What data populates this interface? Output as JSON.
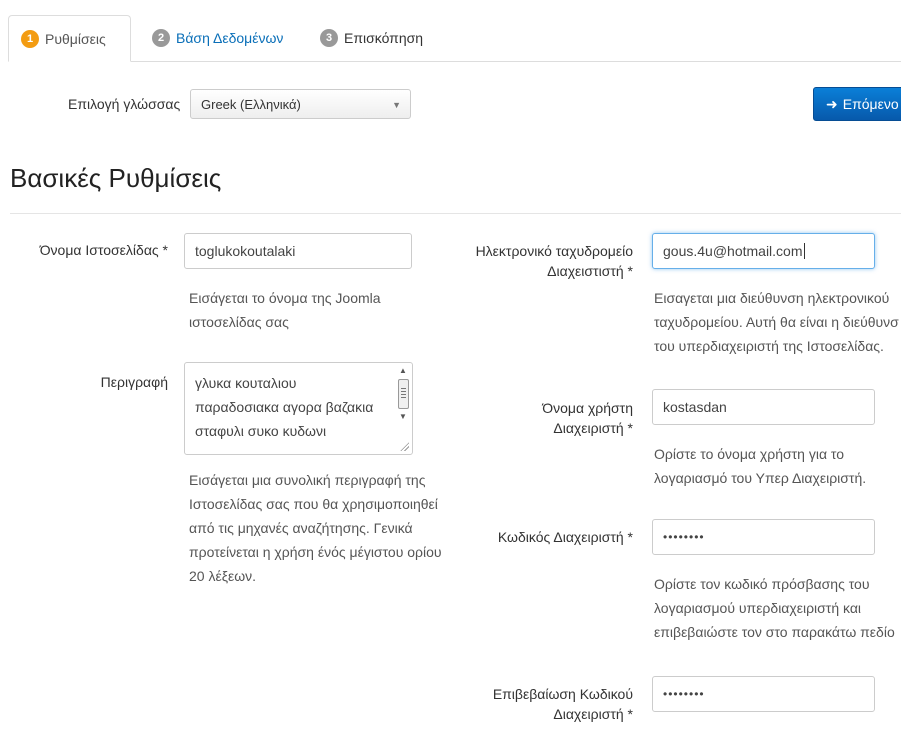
{
  "tabs": [
    {
      "number": "1",
      "label": "Ρυθμίσεις"
    },
    {
      "number": "2",
      "label": "Βάση Δεδομένων"
    },
    {
      "number": "3",
      "label": "Επισκόπηση"
    }
  ],
  "language": {
    "label": "Επιλογή γλώσσας",
    "selected": "Greek (Ελληνικά)"
  },
  "next_button": {
    "icon": "arrow-right-icon",
    "label": "Επόμενο"
  },
  "section_title": "Βασικές Ρυθμίσεις",
  "site_name": {
    "label": "Όνομα Ιστοσελίδας *",
    "value": "toglukokoutalaki",
    "help_line1": "Εισάγεται το όνομα της Joomla",
    "help_line2": "ιστοσελίδας σας"
  },
  "description": {
    "label": "Περιγραφή",
    "lines": [
      "γλυκα κουταλιου",
      "παραδοσιακα αγορα βαζακια",
      "σταφυλι συκο κυδωνι"
    ],
    "help_lines": [
      "Εισάγεται μια συνολική περιγραφή της",
      "Ιστοσελίδας σας που θα χρησιμοποιηθεί",
      "από τις μηχανές αναζήτησης. Γενικά",
      "προτείνεται η χρήση ένός μέγιστου ορίου",
      "20 λέξεων."
    ]
  },
  "admin_email": {
    "label_line1": "Ηλεκτρονικό ταχυδρομείο",
    "label_line2": "Διαχειστιστή *",
    "value": "gous.4u@hotmail.com",
    "help_lines": [
      "Εισαγεται μια διεύθυνση ηλεκτρονικού",
      "ταχυδρομείου. Αυτή θα είναι η διεύθυνσ",
      "του υπερδιαχειριστή της Ιστοσελίδας."
    ]
  },
  "admin_username": {
    "label_line1": "Όνομα χρήστη",
    "label_line2": "Διαχειριστή *",
    "value": "kostasdan",
    "help_lines": [
      "Ορίστε το όνομα χρήστη για το",
      "λογαριασμό του Υπερ Διαχειριστή."
    ]
  },
  "admin_password": {
    "label": "Κωδικός Διαχειριστή *",
    "value": "••••••••",
    "help_lines": [
      "Ορίστε τον κωδικό πρόσβασης του",
      "λογαριασμού υπερδιαχειριστή και",
      "επιβεβαιώστε τον στο παρακάτω πεδίο"
    ]
  },
  "confirm_password": {
    "label_line1": "Επιβεβαίωση Κωδικού",
    "label_line2": "Διαχειριστή *",
    "value": "••••••••"
  },
  "colors": {
    "accent": "#0a6fb8",
    "badge_active": "#f39c12",
    "badge_inactive": "#999999",
    "button": "#0a6fd0"
  }
}
